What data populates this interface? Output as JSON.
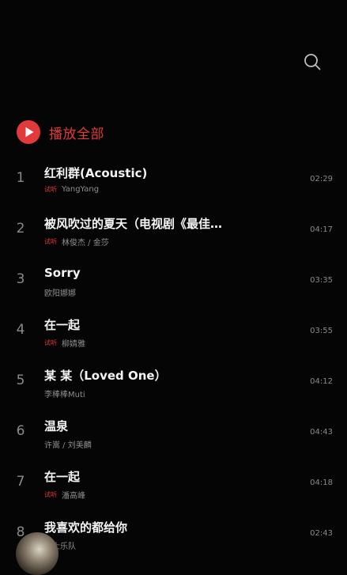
{
  "header": {
    "search_icon": "search-icon"
  },
  "play_all": {
    "icon": "play-circle-icon",
    "label": "播放全部",
    "accent_color": "#e23a3a"
  },
  "songs": [
    {
      "index": "1",
      "title": "红利群(Acoustic)",
      "trial": "试听",
      "artist": "YangYang",
      "duration": "02:29"
    },
    {
      "index": "2",
      "title": "被风吹过的夏天（电视剧《最佳…",
      "trial": "试听",
      "artist": "林俊杰 / 金莎",
      "duration": "04:17"
    },
    {
      "index": "3",
      "title": "Sorry",
      "trial": "",
      "artist": "欧阳娜娜",
      "duration": "03:35"
    },
    {
      "index": "4",
      "title": "在一起",
      "trial": "试听",
      "artist": "柳婧雅",
      "duration": "03:55"
    },
    {
      "index": "5",
      "title": "某 某（Loved One）",
      "trial": "",
      "artist": "李棒棒Muti",
      "duration": "04:12"
    },
    {
      "index": "6",
      "title": "温泉",
      "trial": "",
      "artist": "许嵩 / 刘美麟",
      "duration": "04:43"
    },
    {
      "index": "7",
      "title": "在一起",
      "trial": "试听",
      "artist": "潘高峰",
      "duration": "04:18"
    },
    {
      "index": "8",
      "title": "我喜欢的都给你",
      "trial": "",
      "artist": "卫士乐队",
      "duration": "02:43"
    }
  ]
}
